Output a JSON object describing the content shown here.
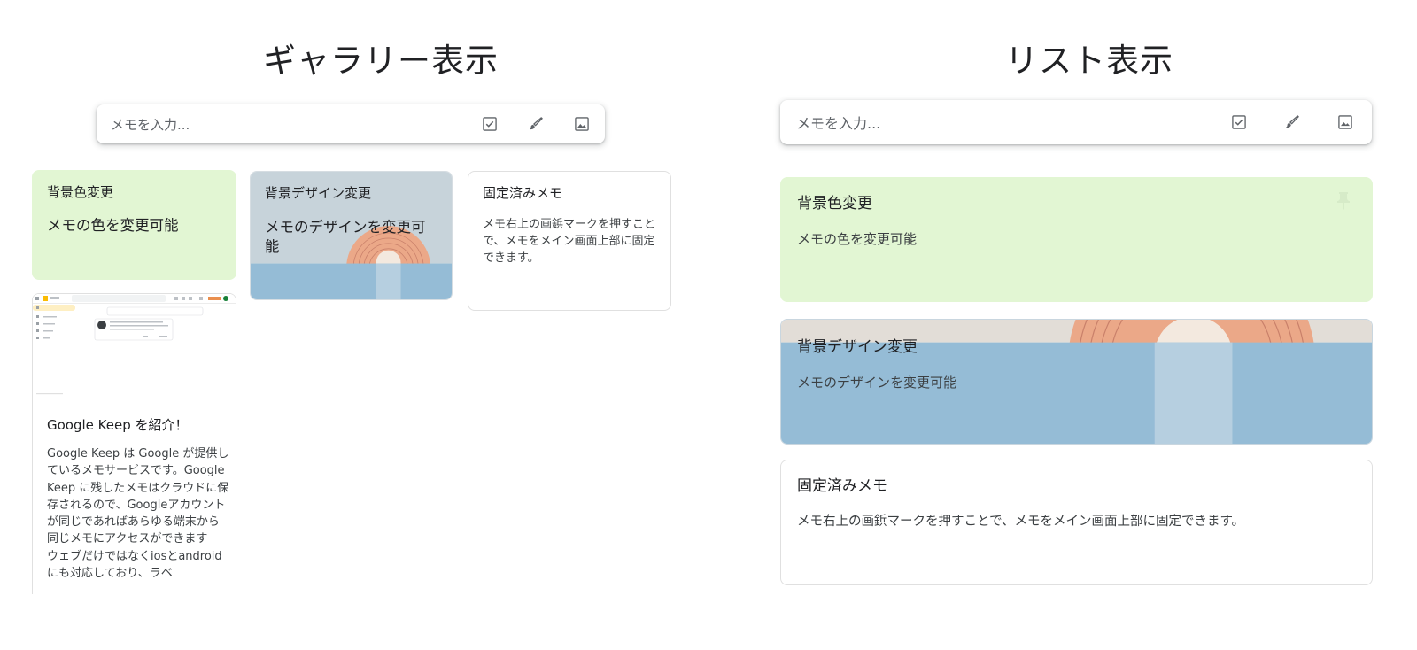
{
  "gallery": {
    "heading": "ギャラリー表示",
    "takenote": {
      "placeholder": "メモを入力..."
    },
    "notes": {
      "bgcolor": {
        "title": "背景色変更",
        "body": "メモの色を変更可能"
      },
      "design": {
        "title": "背景デザイン変更",
        "body": "メモのデザインを変更可能"
      },
      "pinned": {
        "title": "固定済みメモ",
        "body": "メモ右上の画鋲マークを押すことで、メモをメイン画面上部に固定できます。"
      },
      "keep": {
        "title": "Google Keep を紹介！",
        "body": "Google Keep は Google が提供しているメモサービスです。Google Keep に残したメモはクラウドに保存されるので、Googleアカウントが同じであればあらゆる端末から同じメモにアクセスができます\nウェブだけではなくiosとandroidにも対応しており、ラベ"
      }
    }
  },
  "list": {
    "heading": "リスト表示",
    "takenote": {
      "placeholder": "メモを入力..."
    },
    "notes": {
      "bgcolor": {
        "title": "背景色変更",
        "body": "メモの色を変更可能"
      },
      "design": {
        "title": "背景デザイン変更",
        "body": "メモのデザインを変更可能"
      },
      "pinned": {
        "title": "固定済みメモ",
        "body": "メモ右上の画鋲マークを押すことで、メモをメイン画面上部に固定できます。"
      }
    }
  },
  "icons": {
    "checkbox": "checkbox-icon",
    "brush": "brush-icon",
    "image": "image-icon",
    "pin": "pin-icon"
  },
  "colors": {
    "note_green": "#e2f6d3",
    "design_sky": "#c7d3da",
    "design_water": "#95bcd6",
    "design_sun": "#eba888"
  }
}
